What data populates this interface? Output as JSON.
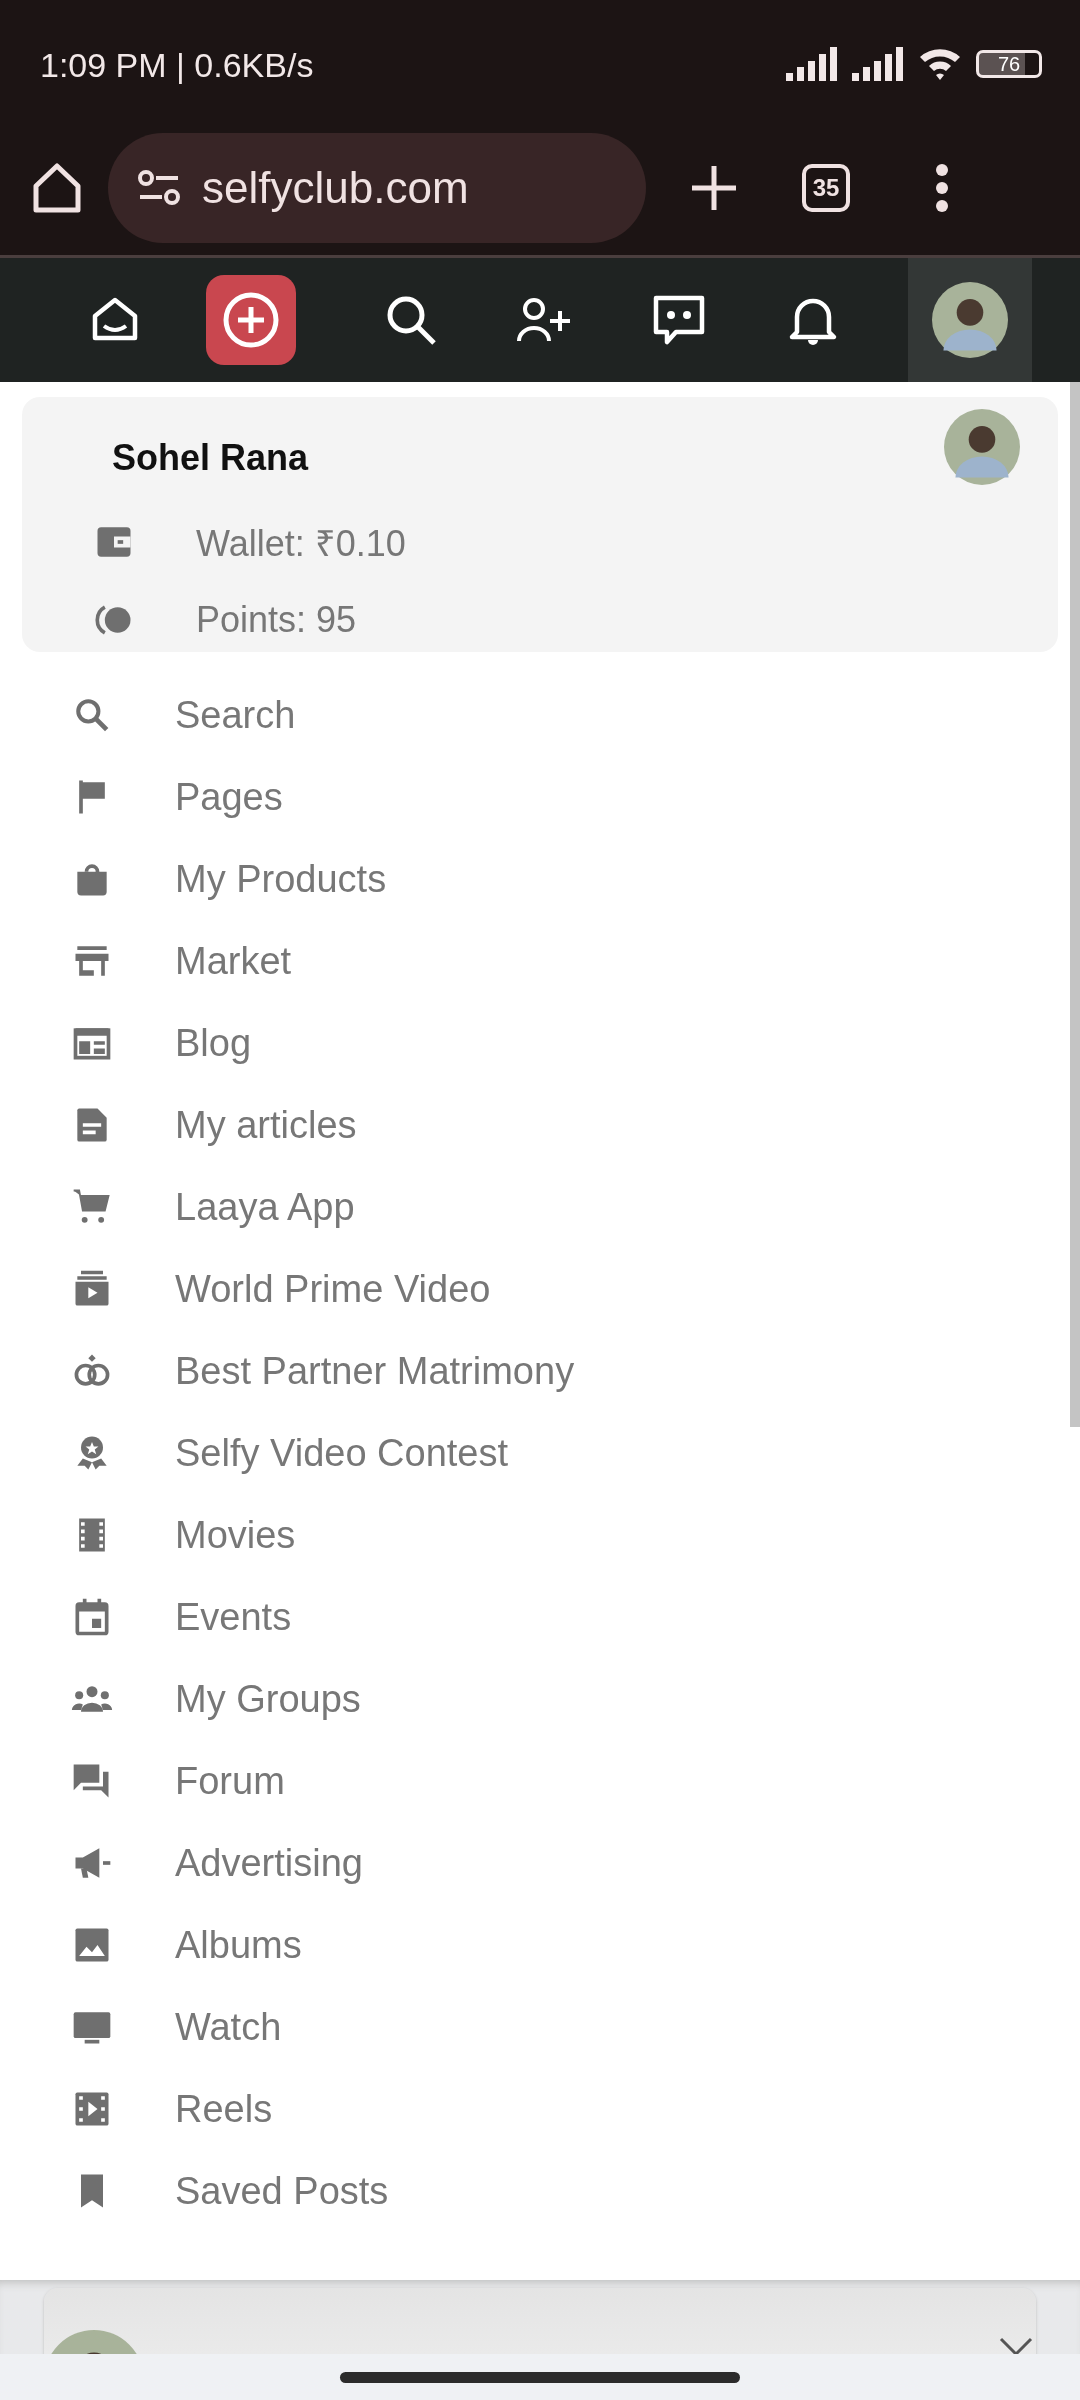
{
  "status_bar": {
    "time": "1:09 PM | 0.6KB/s",
    "battery": "76"
  },
  "browser": {
    "url": "selfyclub.com",
    "tab_count": "35"
  },
  "profile": {
    "name": "Sohel Rana",
    "wallet": "Wallet: ₹0.10",
    "points": "Points: 95"
  },
  "menu": [
    {
      "label": "Search"
    },
    {
      "label": "Pages"
    },
    {
      "label": "My Products"
    },
    {
      "label": "Market"
    },
    {
      "label": "Blog"
    },
    {
      "label": "My articles"
    },
    {
      "label": "Laaya App"
    },
    {
      "label": "World Prime Video"
    },
    {
      "label": "Best Partner Matrimony"
    },
    {
      "label": "Selfy Video Contest"
    },
    {
      "label": "Movies"
    },
    {
      "label": "Events"
    },
    {
      "label": "My Groups"
    },
    {
      "label": "Forum"
    },
    {
      "label": "Advertising"
    },
    {
      "label": "Albums"
    },
    {
      "label": "Watch"
    },
    {
      "label": "Reels"
    },
    {
      "label": "Saved Posts"
    }
  ]
}
